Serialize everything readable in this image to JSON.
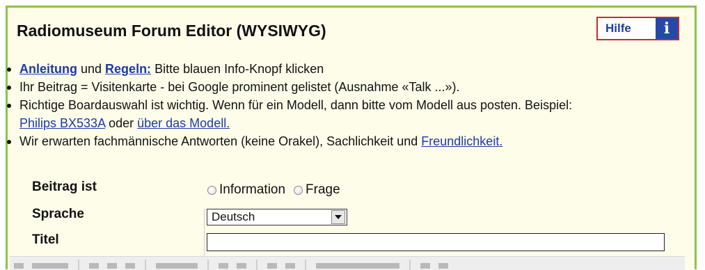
{
  "header": {
    "title": "Radiomuseum Forum Editor (WYSIWYG)",
    "help_label": "Hilfe",
    "info_glyph": "i"
  },
  "bullets": [
    {
      "parts": [
        {
          "t": "Anleitung",
          "link": true
        },
        {
          "t": " und "
        },
        {
          "t": "Regeln:",
          "link": true
        },
        {
          "t": " Bitte blauen Info-Knopf klicken"
        }
      ]
    },
    {
      "parts": [
        {
          "t": "Ihr Beitrag = Visitenkarte - bei Google prominent gelistet (Ausnahme «Talk ...»)."
        }
      ]
    },
    {
      "parts": [
        {
          "t": "Richtige Boardauswahl ist wichtig. Wenn für ein Modell, dann bitte vom Modell aus posten. Beispiel:"
        }
      ],
      "second": [
        {
          "t": "Philips BX533A",
          "link": true
        },
        {
          "t": " oder "
        },
        {
          "t": "über das Modell.",
          "link": true
        }
      ]
    },
    {
      "parts": [
        {
          "t": "Wir erwarten fachmännische Antworten (keine Orakel), Sachlichkeit und "
        },
        {
          "t": "Freundlichkeit.",
          "link": true
        }
      ]
    }
  ],
  "form": {
    "beitrag_label": "Beitrag ist",
    "option_information": "Information",
    "option_frage": "Frage",
    "sprache_label": "Sprache",
    "sprache_value": "Deutsch",
    "titel_label": "Titel",
    "titel_value": ""
  },
  "colors": {
    "accent_border": "#8bc34a",
    "link": "#1c3aa8",
    "help_border": "#cc2a2a"
  }
}
